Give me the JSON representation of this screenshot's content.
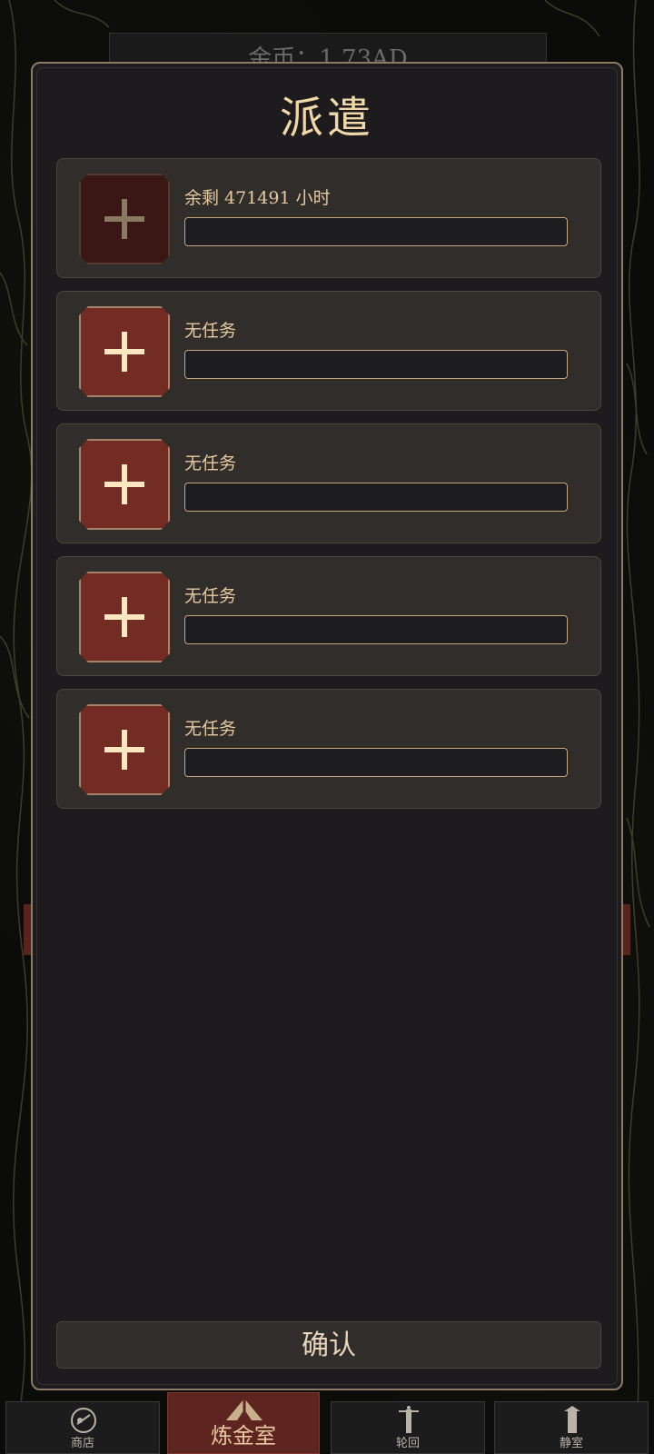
{
  "background_header": {
    "text": "金币：1.73AD"
  },
  "modal": {
    "title": "派遣",
    "slots": [
      {
        "status": "余剩 471491 小时",
        "state": "busy"
      },
      {
        "status": "无任务",
        "state": "idle"
      },
      {
        "status": "无任务",
        "state": "idle"
      },
      {
        "status": "无任务",
        "state": "idle"
      },
      {
        "status": "无任务",
        "state": "idle"
      }
    ],
    "confirm_label": "确认"
  },
  "bottom_nav": {
    "items": [
      {
        "label": "商店",
        "icon": "shop-icon"
      },
      {
        "label": "炼金室",
        "icon": "tent-icon",
        "active": true
      },
      {
        "label": "轮回",
        "icon": "pillar-icon"
      },
      {
        "label": "静室",
        "icon": "tower-icon"
      }
    ]
  },
  "colors": {
    "accent": "#f0d7a8",
    "slot_button": "#722c24",
    "slot_button_busy": "#3a1714",
    "active_tab": "#5e2520"
  }
}
